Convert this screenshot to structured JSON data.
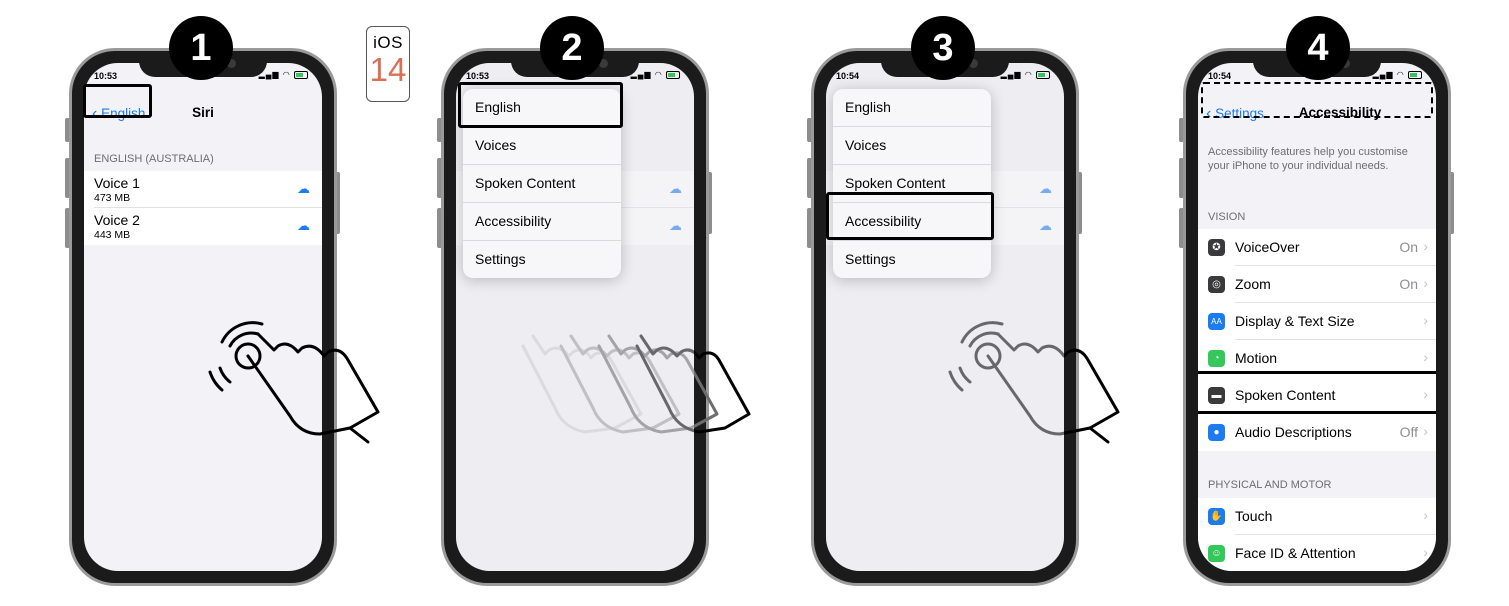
{
  "ios_logo": {
    "top": "iOS",
    "num": "14"
  },
  "steps": [
    "1",
    "2",
    "3",
    "4"
  ],
  "phone1": {
    "time": "10:53",
    "back_label": "English",
    "title": "Siri",
    "section": "ENGLISH (AUSTRALIA)",
    "voices": [
      {
        "name": "Voice 1",
        "size": "473 MB"
      },
      {
        "name": "Voice 2",
        "size": "443 MB"
      }
    ]
  },
  "phone2": {
    "time": "10:53",
    "menu": [
      "English",
      "Voices",
      "Spoken Content",
      "Accessibility",
      "Settings"
    ]
  },
  "phone3": {
    "time": "10:54",
    "menu": [
      "English",
      "Voices",
      "Spoken Content",
      "Accessibility",
      "Settings"
    ]
  },
  "phone4": {
    "time": "10:54",
    "back_label": "Settings",
    "title": "Accessibility",
    "description": "Accessibility features help you customise your iPhone to your individual needs.",
    "vision_header": "VISION",
    "vision_rows": [
      {
        "label": "VoiceOver",
        "value": "On",
        "icon": "voiceover-icon",
        "color": "#3a3a3c"
      },
      {
        "label": "Zoom",
        "value": "On",
        "icon": "zoom-icon",
        "color": "#3a3a3c"
      },
      {
        "label": "Display & Text Size",
        "value": "",
        "icon": "text-size-icon",
        "color": "#1a7cf0"
      },
      {
        "label": "Motion",
        "value": "",
        "icon": "motion-icon",
        "color": "#34c759"
      },
      {
        "label": "Spoken Content",
        "value": "",
        "icon": "speech-bubble-icon",
        "color": "#3a3a3c"
      },
      {
        "label": "Audio Descriptions",
        "value": "Off",
        "icon": "audio-description-icon",
        "color": "#1a7cf0"
      }
    ],
    "physical_header": "PHYSICAL AND MOTOR",
    "physical_rows": [
      {
        "label": "Touch",
        "value": "",
        "icon": "hand-touch-icon",
        "color": "#1a7cf0"
      },
      {
        "label": "Face ID & Attention",
        "value": "",
        "icon": "face-id-icon",
        "color": "#34c759"
      }
    ]
  }
}
